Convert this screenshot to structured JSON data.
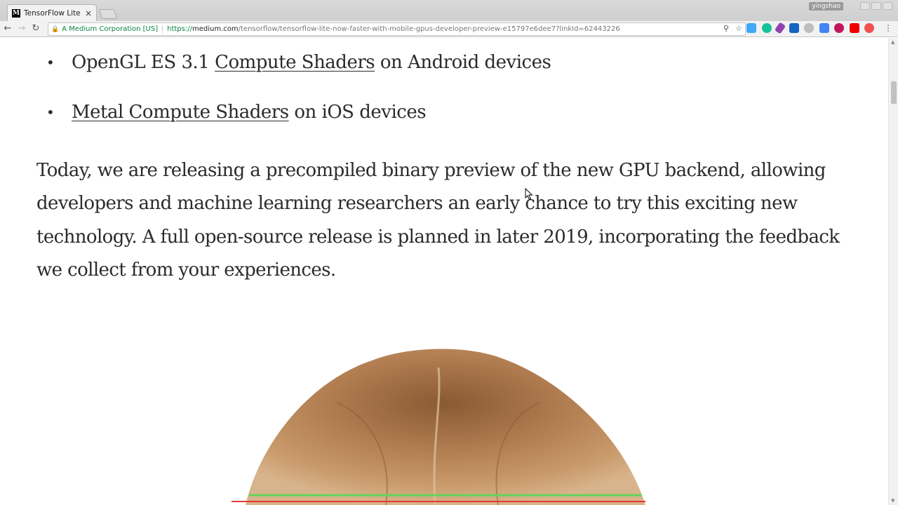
{
  "browser": {
    "tab_title": "TensorFlow Lite Now F",
    "tab_favicon": "M",
    "tab_close": "×",
    "profile_name": "yingshao",
    "security_label": "A Medium Corporation [US]",
    "url_protocol": "https://",
    "url_host": "medium.com",
    "url_path": "/tensorflow/tensorflow-lite-now-faster-with-mobile-gpus-developer-preview-e15797e6dee7?linkId=62443226",
    "nav_icons": [
      "back-icon",
      "forward-icon",
      "reload-icon"
    ],
    "extension_icons": [
      "zoom-icon",
      "bookmark-star-icon",
      "twitter-extension-icon",
      "grammarly-icon",
      "pen-extension-icon",
      "save-extension-icon",
      "circle-extension-icon",
      "translate-icon",
      "record-extension-icon",
      "youtube-extension-icon",
      "profile-extension-icon"
    ]
  },
  "article": {
    "bullets": [
      {
        "prefix": "OpenGL ES 3.1 ",
        "link": "Compute Shaders",
        "suffix": " on Android devices"
      },
      {
        "prefix": "",
        "link": "Metal Compute Shaders",
        "suffix": " on iOS devices"
      }
    ],
    "paragraph": "Today, we are releasing a precompiled binary preview of the new GPU backend, allowing developers and machine learning researchers an early chance to try this exciting new technology. A full open-source release is planned in later 2019, incorporating the feedback we collect from your experiences."
  },
  "colors": {
    "text": "#2b2b2b",
    "secure_green": "#0b8043",
    "hair": "#b98a5e"
  }
}
